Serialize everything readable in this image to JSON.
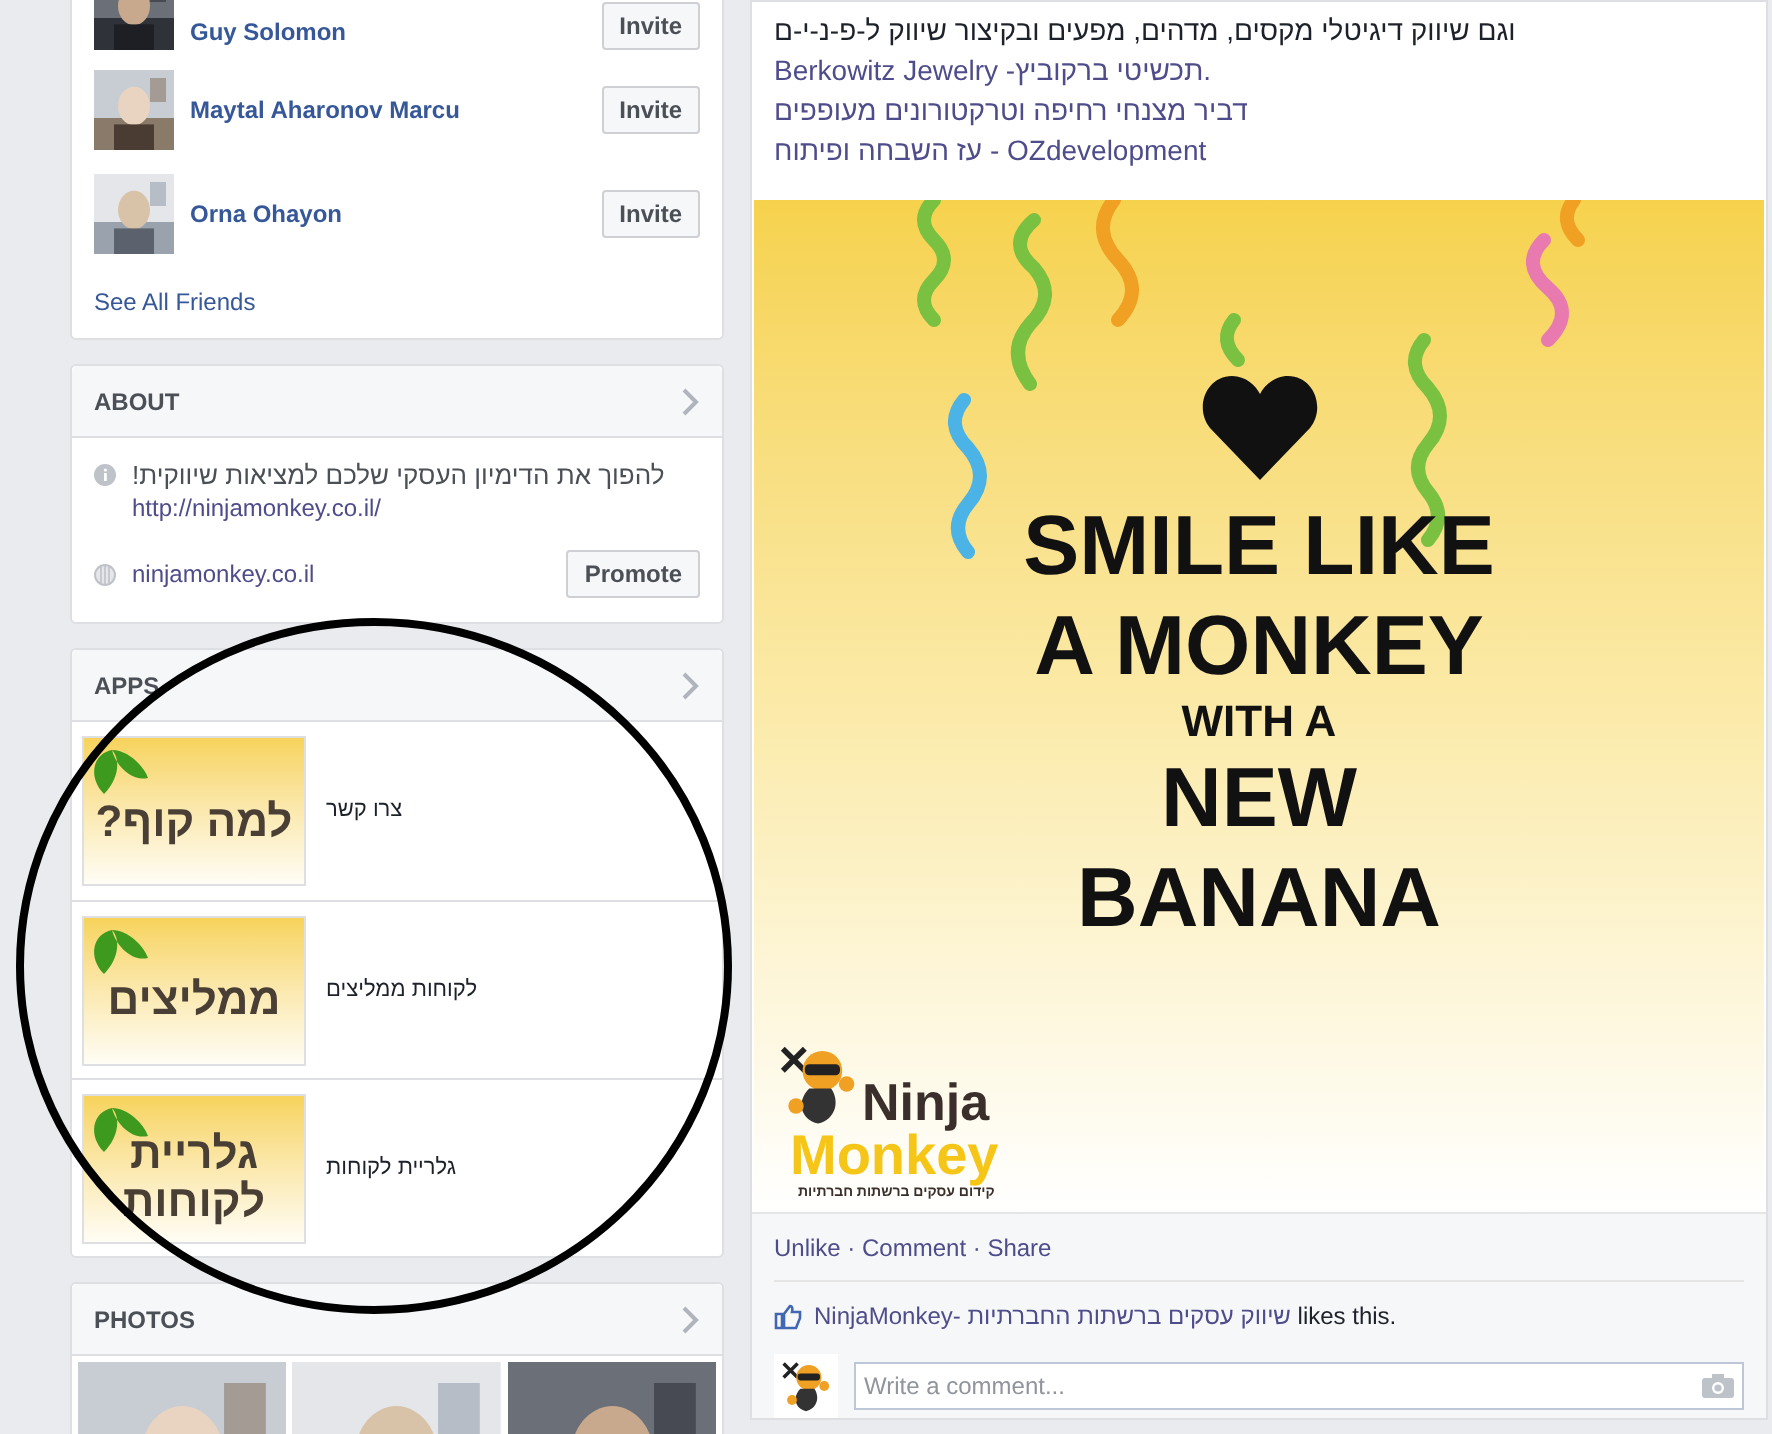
{
  "friends": {
    "items": [
      {
        "name": "Guy Solomon",
        "button": "Invite"
      },
      {
        "name": "Maytal Aharonov Marcu",
        "button": "Invite"
      },
      {
        "name": "Orna Ohayon",
        "button": "Invite"
      }
    ],
    "see_all": "See All Friends"
  },
  "about": {
    "title": "ABOUT",
    "description": "להפוך את הדימיון העסקי שלכם למציאות שיווקית!",
    "url": "http://ninjamonkey.co.il/",
    "website": "ninjamonkey.co.il",
    "button": "Promote"
  },
  "apps": {
    "title": "APPS",
    "items": [
      {
        "name": "צרו קשר",
        "thumbnail_text": [
          "למה קוף?"
        ]
      },
      {
        "name": "לקוחות ממליצים",
        "thumbnail_text": [
          "ממליצים"
        ]
      },
      {
        "name": "גלריית לקוחות",
        "thumbnail_text": [
          "גלריית",
          "לקוחות"
        ]
      }
    ]
  },
  "photos": {
    "title": "PHOTOS"
  },
  "post": {
    "lines": [
      {
        "kind": "text",
        "text": "וגם שיווק דיגיטלי מקסים, מדהים, מפעים ובקיצור שיווק ל-פ-נ-י-ם"
      },
      {
        "kind": "link",
        "text": "Berkowitz Jewelry -תכשיטי ברקוביץ."
      },
      {
        "kind": "link",
        "text": "דביר מצנחי רחיפה וטרקטורונים מעופפים"
      },
      {
        "kind": "link",
        "text": "עז השבחה ופיתוח - OZdevelopment"
      }
    ],
    "image": {
      "lines": [
        {
          "text": "SMILE LIKE",
          "kind": "large"
        },
        {
          "text": "A MONKEY",
          "kind": "large"
        },
        {
          "text": "WITH A",
          "kind": "small"
        },
        {
          "text": "NEW",
          "kind": "large"
        },
        {
          "text": "BANANA",
          "kind": "large"
        }
      ],
      "logo": {
        "name_lines": [
          "Ninja",
          "Monkey"
        ],
        "tagline": "קידום עסקים ברשתות חברתיות"
      }
    },
    "actions": "Unlike · Comment · Share",
    "likes": {
      "name": "NinjaMonkey- שיווק עסקים ברשתות החברתיות",
      "suffix": "likes this."
    },
    "comment_placeholder": "Write a comment..."
  }
}
